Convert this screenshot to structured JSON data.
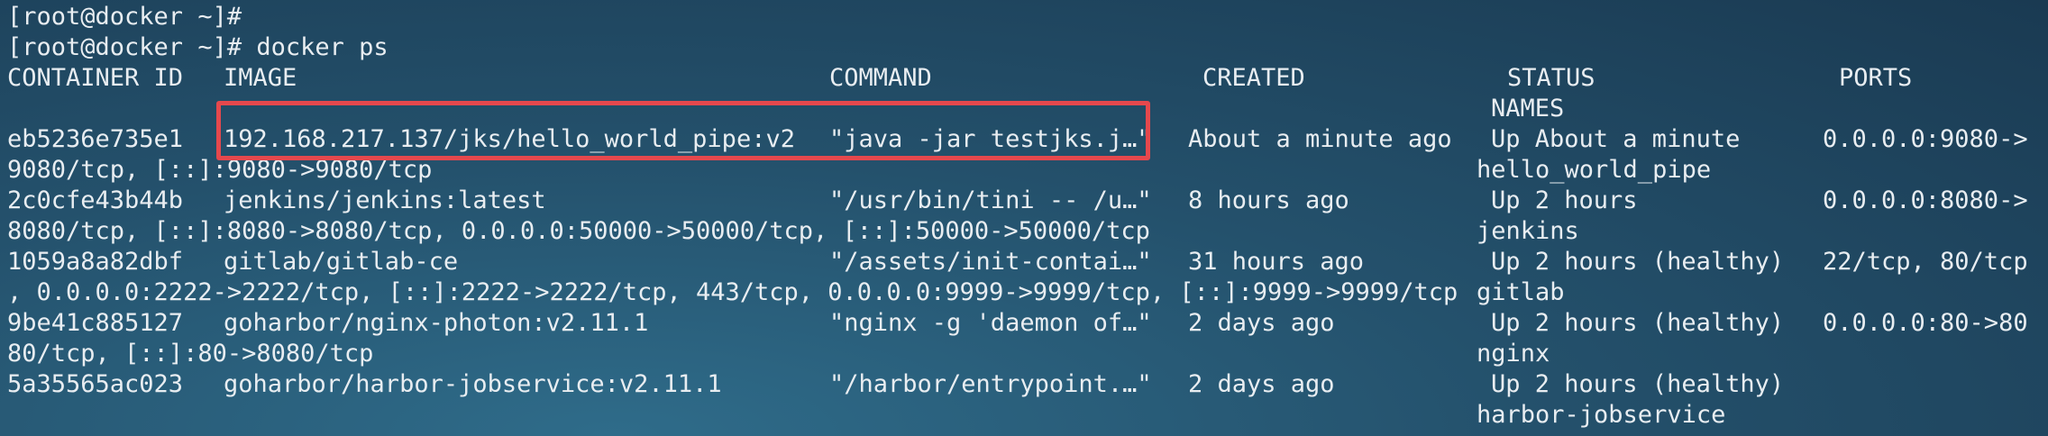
{
  "terminal": {
    "prompt1": "[root@docker ~]#",
    "prompt2": "[root@docker ~]# docker ps",
    "headers": {
      "container_id": "CONTAINER ID",
      "image": "IMAGE",
      "command": "COMMAND",
      "created": "CREATED",
      "status": "STATUS",
      "ports": "PORTS",
      "names": "NAMES"
    },
    "containers": [
      {
        "id": "eb5236e735e1",
        "image": "192.168.217.137/jks/hello_world_pipe:v2",
        "command": "\"java -jar testjks.j…\"",
        "created": "About a minute ago",
        "status": "Up About a minute",
        "ports_start": "0.0.0.0:9080->",
        "ports_cont": "9080/tcp, [::]:9080->9080/tcp",
        "name": "hello_world_pipe"
      },
      {
        "id": "2c0cfe43b44b",
        "image": "jenkins/jenkins:latest",
        "command": "\"/usr/bin/tini -- /u…\"",
        "created": "8 hours ago",
        "status": "Up 2 hours",
        "ports_start": "0.0.0.0:8080->",
        "ports_cont": "8080/tcp, [::]:8080->8080/tcp, 0.0.0.0:50000->50000/tcp, [::]:50000->50000/tcp",
        "name": "jenkins"
      },
      {
        "id": "1059a8a82dbf",
        "image": "gitlab/gitlab-ce",
        "command": "\"/assets/init-contai…\"",
        "created": "31 hours ago",
        "status": "Up 2 hours (healthy)",
        "ports_start": "22/tcp, 80/tcp",
        "ports_cont": ", 0.0.0.0:2222->2222/tcp, [::]:2222->2222/tcp, 443/tcp, 0.0.0.0:9999->9999/tcp, [::]:9999->9999/tcp",
        "name": "gitlab"
      },
      {
        "id": "9be41c885127",
        "image": "goharbor/nginx-photon:v2.11.1",
        "command": "\"nginx -g 'daemon of…\"",
        "created": "2 days ago",
        "status": "Up 2 hours (healthy)",
        "ports_start": "0.0.0.0:80->80",
        "ports_cont": "80/tcp, [::]:80->8080/tcp",
        "name": "nginx"
      },
      {
        "id": "5a35565ac023",
        "image": "goharbor/harbor-jobservice:v2.11.1",
        "command": "\"/harbor/entrypoint.…\"",
        "created": "2 days ago",
        "status": "Up 2 hours (healthy)",
        "ports_start": "",
        "ports_cont": "",
        "name": "harbor-jobservice"
      }
    ]
  },
  "colors": {
    "text": "#e8edf1",
    "highlight": "#e5484d"
  }
}
